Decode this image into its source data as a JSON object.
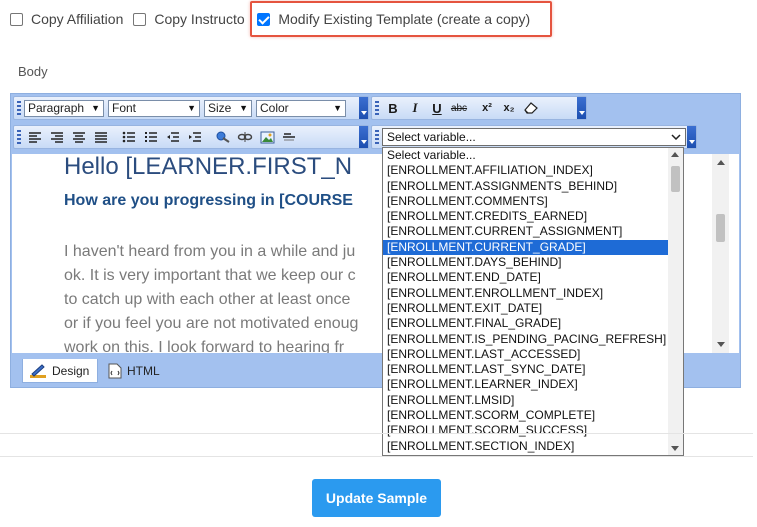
{
  "options": [
    {
      "label": "Copy Affiliation",
      "checked": false
    },
    {
      "label": "Copy Instructo",
      "checked": false
    },
    {
      "label": "Modify Existing Template (create a copy)",
      "checked": true
    }
  ],
  "body_label": "Body",
  "toolbar": {
    "paragraph": "Paragraph",
    "font": "Font",
    "size": "Size",
    "color": "Color",
    "bold": "B",
    "italic": "I",
    "underline": "U",
    "strike": "abc",
    "superscript": "x²",
    "subscript": "x₂"
  },
  "document": {
    "heading": "Hello [LEARNER.FIRST_N",
    "subheading": "How are you progressing in [COURSE",
    "lines": [
      "I haven't heard from you in a while and ju",
      "ok. It is very important that we keep our c",
      "to catch up with each other at least once",
      "or if you feel you are not motivated enoug",
      "work on this. I look forward to hearing fr"
    ]
  },
  "modes": {
    "design": "Design",
    "html": "HTML"
  },
  "variable_select": {
    "value": "Select variable...",
    "selected_index": 6,
    "options": [
      "Select variable...",
      "[ENROLLMENT.AFFILIATION_INDEX]",
      "[ENROLLMENT.ASSIGNMENTS_BEHIND]",
      "[ENROLLMENT.COMMENTS]",
      "[ENROLLMENT.CREDITS_EARNED]",
      "[ENROLLMENT.CURRENT_ASSIGNMENT]",
      "[ENROLLMENT.CURRENT_GRADE]",
      "[ENROLLMENT.DAYS_BEHIND]",
      "[ENROLLMENT.END_DATE]",
      "[ENROLLMENT.ENROLLMENT_INDEX]",
      "[ENROLLMENT.EXIT_DATE]",
      "[ENROLLMENT.FINAL_GRADE]",
      "[ENROLLMENT.IS_PENDING_PACING_REFRESH]",
      "[ENROLLMENT.LAST_ACCESSED]",
      "[ENROLLMENT.LAST_SYNC_DATE]",
      "[ENROLLMENT.LEARNER_INDEX]",
      "[ENROLLMENT.LMSID]",
      "[ENROLLMENT.SCORM_COMPLETE]",
      "[ENROLLMENT.SCORM_SUCCESS]",
      "[ENROLLMENT.SECTION_INDEX]"
    ]
  },
  "update_button": "Update Sample",
  "colors": {
    "accent": "#2b9aef",
    "highlight": "#e5543f",
    "selection": "#1e6bd6"
  }
}
